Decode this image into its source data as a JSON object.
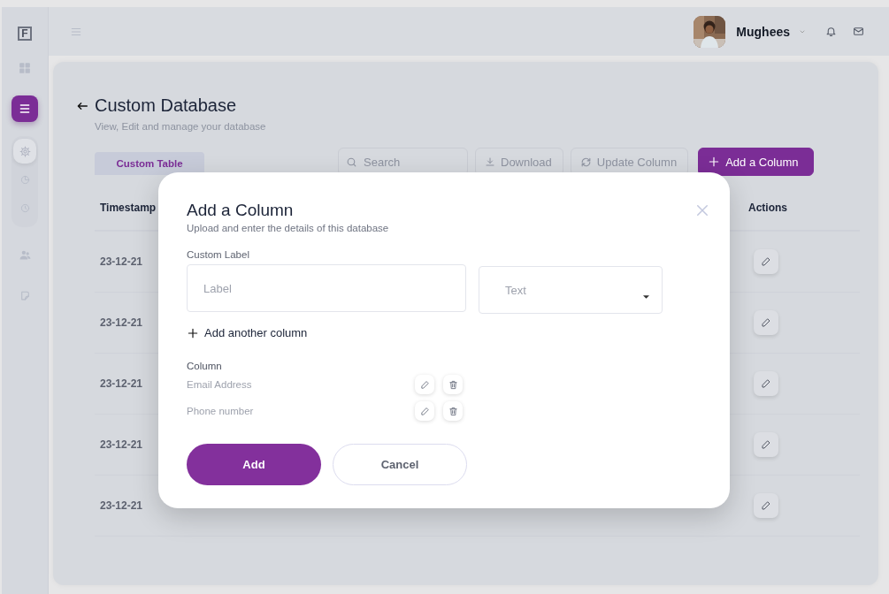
{
  "sidebar": {
    "logo": "F",
    "items": [
      {
        "kind": "grid",
        "selected": false
      },
      {
        "kind": "menu",
        "selected": true
      },
      {
        "kind": "group",
        "children": [
          {
            "kind": "gear",
            "selected": true
          },
          {
            "kind": "pie",
            "selected": false
          },
          {
            "kind": "clock",
            "selected": false
          }
        ]
      },
      {
        "kind": "people",
        "selected": false
      },
      {
        "kind": "doc",
        "selected": false
      }
    ]
  },
  "header": {
    "user_name": "Mughees"
  },
  "page": {
    "title": "Custom Database",
    "subtitle": "View, Edit and manage your database"
  },
  "tabs": [
    {
      "label": "Custom Table",
      "selected": true
    }
  ],
  "search": {
    "placeholder": "Search"
  },
  "toolbar_buttons": [
    {
      "label": "Download",
      "kind": "download"
    },
    {
      "label": "Update Column",
      "kind": "update"
    },
    {
      "label": "Add a Column",
      "kind": "add"
    }
  ],
  "table": {
    "columns": [
      "Timestamp",
      "Actions"
    ],
    "rows": [
      {
        "timestamp": "23-12-21"
      },
      {
        "timestamp": "23-12-21"
      },
      {
        "timestamp": "23-12-21"
      },
      {
        "timestamp": "23-12-21"
      },
      {
        "timestamp": "23-12-21"
      }
    ]
  },
  "modal": {
    "title": "Add a Column",
    "subtitle": "Upload and enter the details of this database",
    "field_label": "Custom Label",
    "label_field": {
      "placeholder": "Label"
    },
    "type_select": {
      "value": "Text"
    },
    "add_another": "Add another column",
    "columns_heading": "Column",
    "columns": [
      {
        "name": "Email Address"
      },
      {
        "name": "Phone number"
      }
    ],
    "buttons": [
      {
        "label": "Add",
        "kind": "primary"
      },
      {
        "label": "Cancel",
        "kind": "secondary"
      }
    ]
  }
}
